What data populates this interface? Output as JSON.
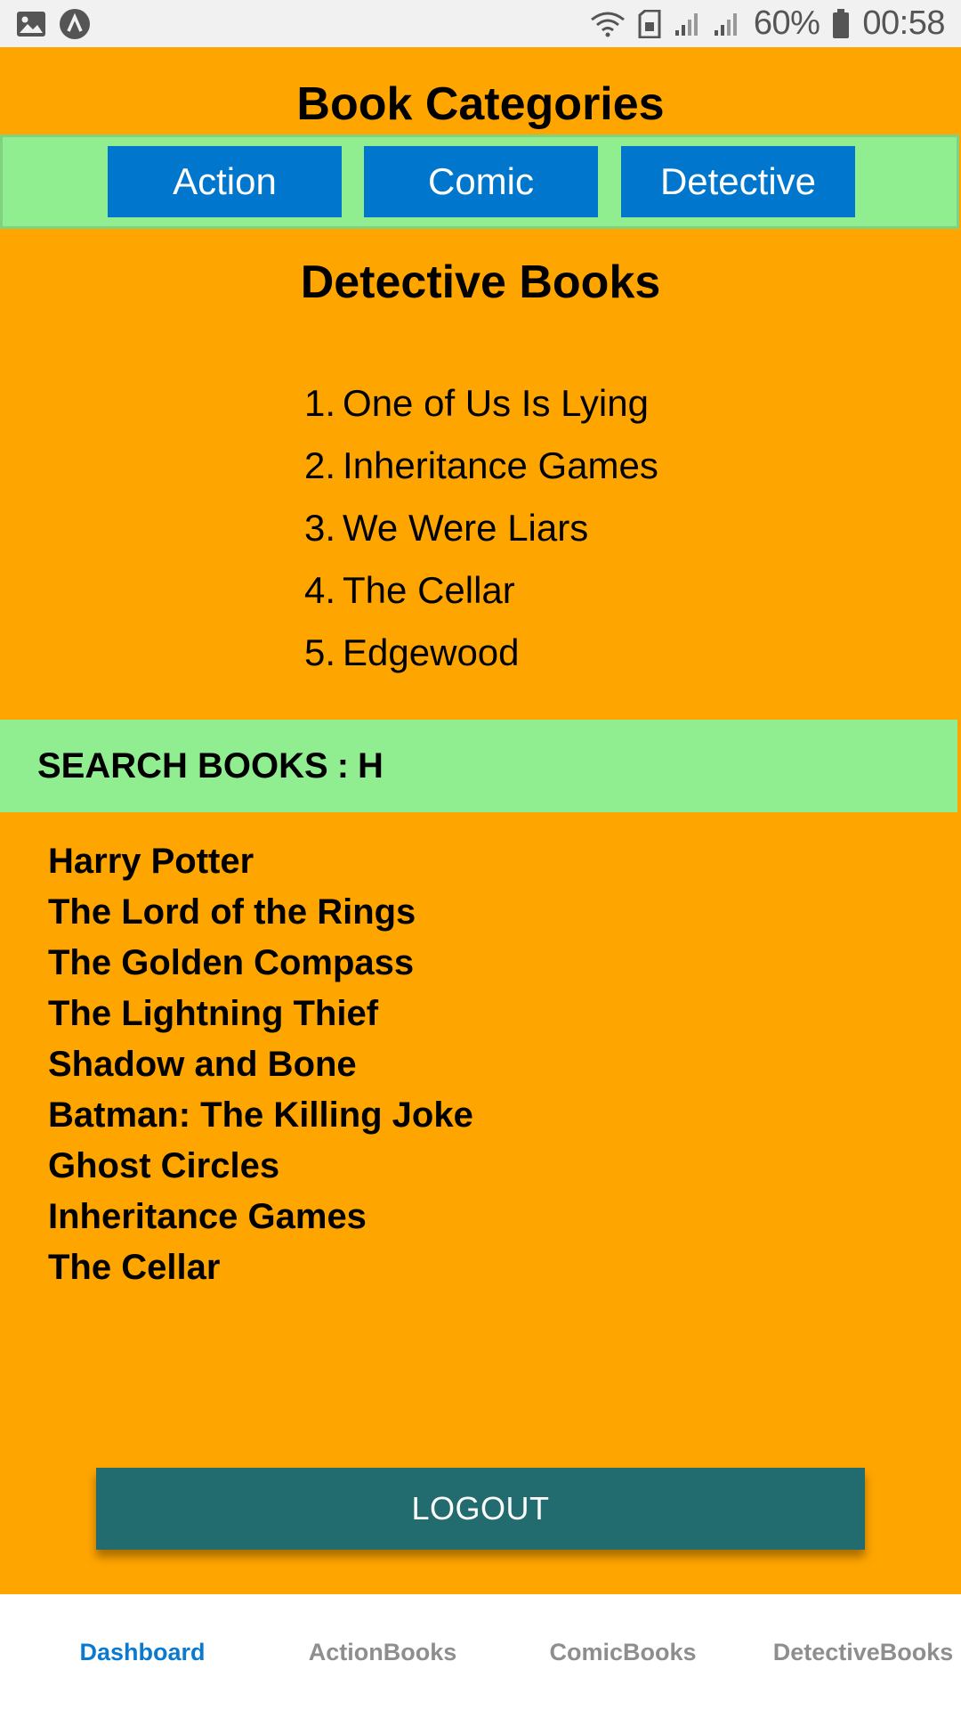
{
  "status_bar": {
    "battery_percent": "60%",
    "time": "00:58",
    "icons": [
      "image-icon",
      "app-notification-icon",
      "wifi-icon",
      "sim-icon",
      "signal-icon",
      "signal-icon",
      "battery-icon"
    ]
  },
  "header": {
    "title": "Book Categories"
  },
  "categories": {
    "buttons": [
      {
        "label": "Action"
      },
      {
        "label": "Comic"
      },
      {
        "label": "Detective"
      }
    ]
  },
  "detective": {
    "title": "Detective Books",
    "items": [
      {
        "num": "1.",
        "title": "One of Us Is Lying"
      },
      {
        "num": "2.",
        "title": "Inheritance Games"
      },
      {
        "num": "3.",
        "title": "We Were Liars"
      },
      {
        "num": "4.",
        "title": "The Cellar"
      },
      {
        "num": "5.",
        "title": "Edgewood"
      }
    ]
  },
  "search": {
    "label": "SEARCH BOOKS",
    "separator": ":",
    "value": "H"
  },
  "results": [
    "Harry Potter",
    "The Lord of the Rings",
    "The Golden Compass",
    "The Lightning Thief",
    "Shadow and Bone",
    "Batman: The Killing Joke",
    "Ghost Circles",
    "Inheritance Games",
    "The Cellar"
  ],
  "logout": {
    "label": "LOGOUT"
  },
  "tabs": [
    {
      "label": "Dashboard",
      "active": true
    },
    {
      "label": "ActionBooks",
      "active": false
    },
    {
      "label": "ComicBooks",
      "active": false
    },
    {
      "label": "DetectiveBooks",
      "active": false
    }
  ],
  "colors": {
    "background": "#FFA500",
    "category_bar": "#90EE90",
    "category_button": "#0077CC",
    "logout_button": "#226B6F",
    "active_tab": "#0A7AD1",
    "inactive_tab": "#8E8E8E"
  }
}
